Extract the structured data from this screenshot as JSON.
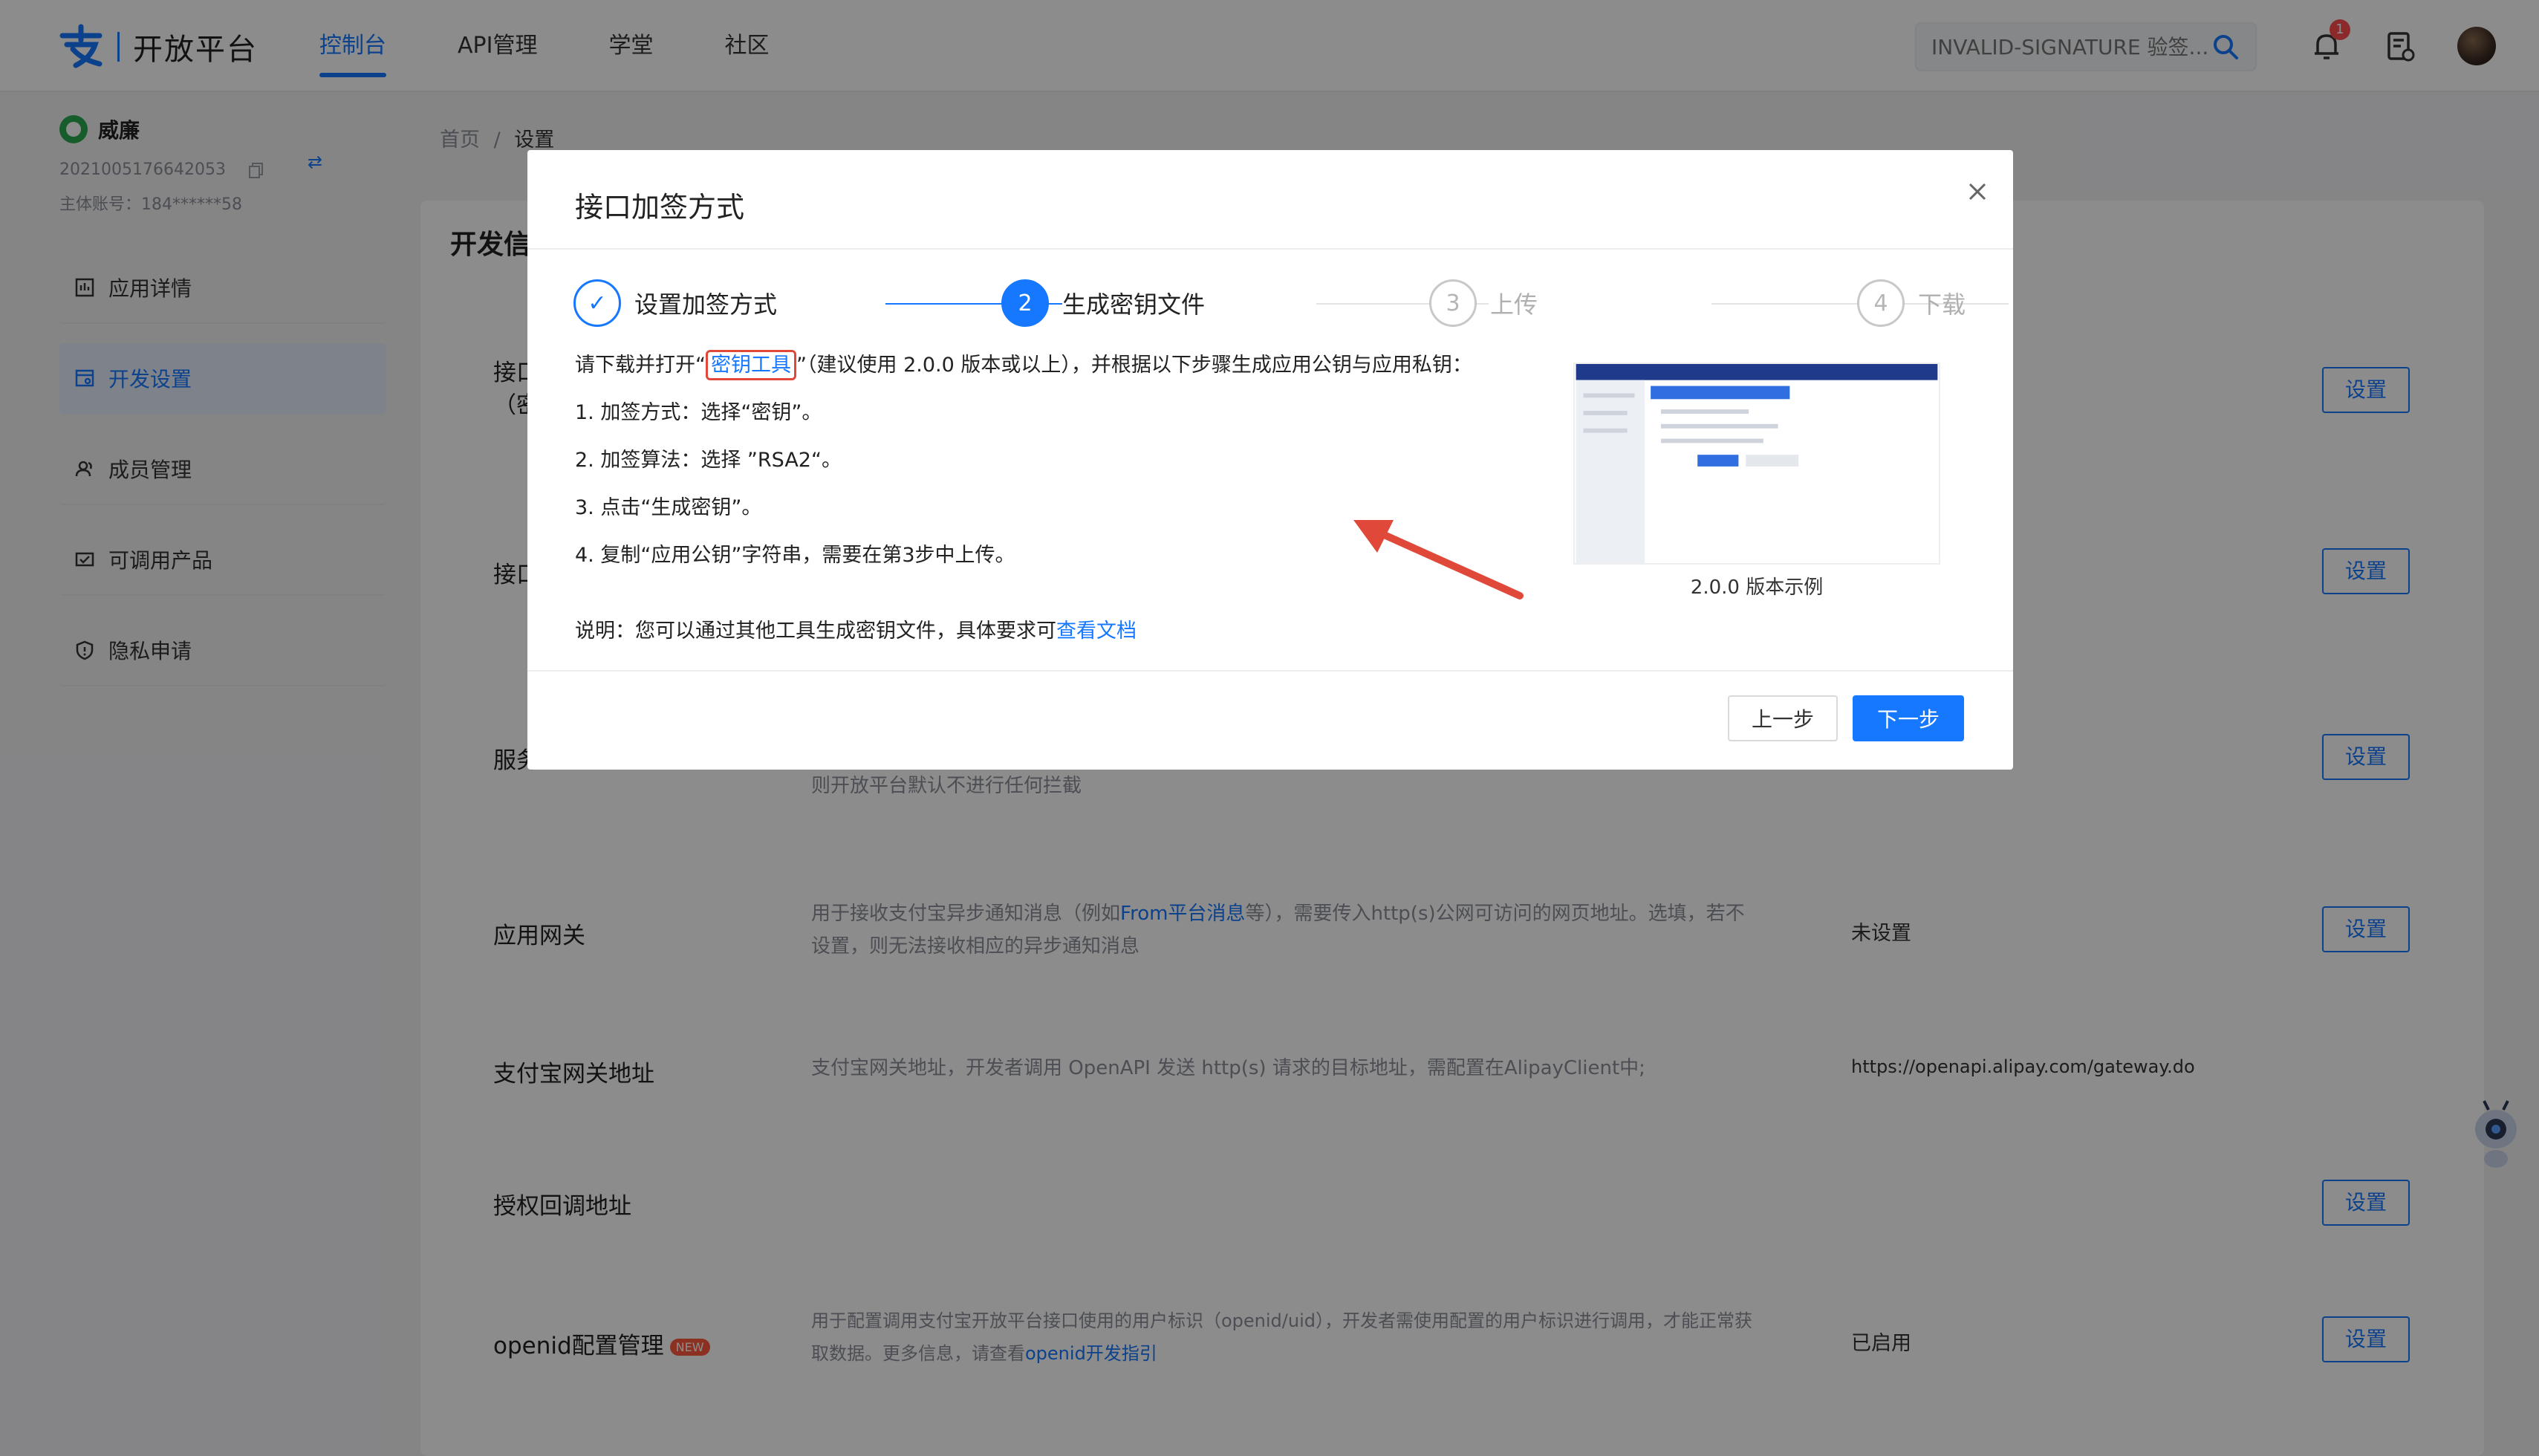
{
  "header": {
    "logo_text": "开放平台",
    "tabs": [
      {
        "label": "控制台",
        "active": true
      },
      {
        "label": "API管理",
        "active": false
      },
      {
        "label": "学堂",
        "active": false
      },
      {
        "label": "社区",
        "active": false
      }
    ],
    "search_placeholder": "INVALID-SIGNATURE 验签...",
    "notification_count": "1"
  },
  "sidebar": {
    "user_name": "威廉",
    "user_id": "2021005176642053",
    "main_account": "主体账号：184******58",
    "items": [
      {
        "label": "应用详情",
        "icon": "app-detail-icon",
        "active": false
      },
      {
        "label": "开发设置",
        "icon": "dev-settings-icon",
        "active": true
      },
      {
        "label": "成员管理",
        "icon": "members-icon",
        "active": false
      },
      {
        "label": "可调用产品",
        "icon": "products-icon",
        "active": false
      },
      {
        "label": "隐私申请",
        "icon": "privacy-icon",
        "active": false
      }
    ]
  },
  "breadcrumb": {
    "home": "首页",
    "sep": "/",
    "current": "设置"
  },
  "panel": {
    "title": "开发信",
    "rows": [
      {
        "label": "接口",
        "label2": "（密",
        "desc": "",
        "value": "",
        "button": "设置"
      },
      {
        "label": "接口",
        "label2": "",
        "desc": "",
        "value": "",
        "button": "设置"
      },
      {
        "label": "服务",
        "label2": "",
        "desc": "则开放平台默认不进行任何拦截",
        "value": "",
        "button": "设置"
      },
      {
        "label": "应用网关",
        "desc_a": "用于接收支付宝异步通知消息（例如",
        "desc_link": "From平台消息",
        "desc_b": "等），需要传入http(s)公网可访问的网页地址。选填，若不设置，则无法接收相应的异步通知消息",
        "value": "未设置",
        "button": "设置"
      },
      {
        "label": "支付宝网关地址",
        "desc": "支付宝网关地址，开发者调用 OpenAPI 发送 http(s) 请求的目标地址，需配置在AlipayClient中;",
        "value": "https://openapi.alipay.com/gateway.do"
      },
      {
        "label": "授权回调地址",
        "desc": "",
        "value": "",
        "button": "设置"
      },
      {
        "label": "openid配置管理",
        "tag": "NEW",
        "desc_a": "用于配置调用支付宝开放平台接口使用的用户标识（openid/uid），开发者需使用配置的用户标识进行调用，才能正常获取数据。更多信息，请查看",
        "desc_link": "openid开发指引",
        "value": "已启用",
        "button": "设置"
      }
    ]
  },
  "modal": {
    "title": "接口加签方式",
    "steps": [
      {
        "num": "✓",
        "label": "设置加签方式",
        "state": "done"
      },
      {
        "num": "2",
        "label": "生成密钥文件",
        "state": "current"
      },
      {
        "num": "3",
        "label": "上传",
        "state": "pending"
      },
      {
        "num": "4",
        "label": "下载",
        "state": "pending"
      }
    ],
    "intro_a": "请下载并打开“",
    "intro_link": "密钥工具",
    "intro_b": "”（建议使用 2.0.0 版本或以上），并根据以下步骤生成应用公钥与应用私钥：",
    "steps_text": [
      "1. 加签方式：选择“密钥”。",
      "2. 加签算法：选择 ”RSA2“。",
      "3. 点击“生成密钥”。",
      "4. 复制“应用公钥”字符串，需要在第3步中上传。"
    ],
    "note_a": "说明：您可以通过其他工具生成密钥文件，具体要求可",
    "note_link": "查看文档",
    "preview_caption": "2.0.0 版本示例",
    "btn_prev": "上一步",
    "btn_next": "下一步"
  },
  "colors": {
    "primary": "#1677ff",
    "highlight": "#e0493a",
    "new_tag": "#ff5a3c"
  }
}
